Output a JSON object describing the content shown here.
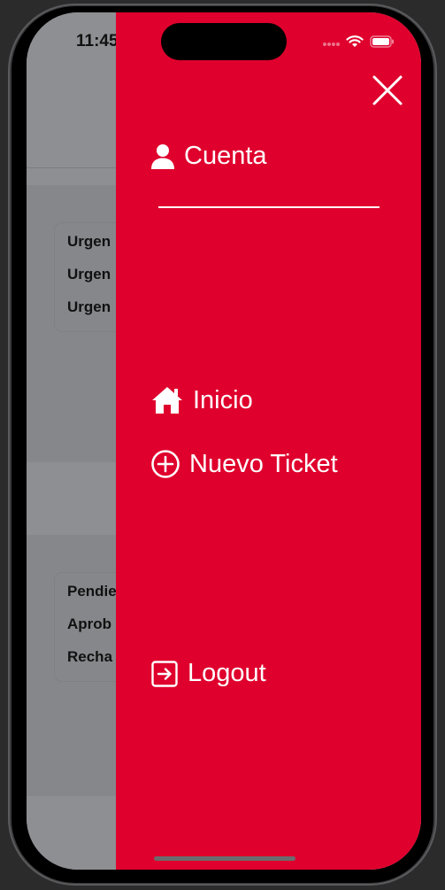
{
  "status_bar": {
    "time": "11:45"
  },
  "background_app": {
    "priority_items": [
      "Urgen",
      "Urgen",
      "Urgen"
    ],
    "status_items": [
      "Pendie",
      "Aprob",
      "Recha"
    ]
  },
  "menu": {
    "account_label": "Cuenta",
    "items": [
      {
        "label": "Inicio",
        "icon": "home-icon"
      },
      {
        "label": "Nuevo Ticket",
        "icon": "plus-circle-icon"
      }
    ],
    "logout_label": "Logout"
  },
  "colors": {
    "menu_bg": "#df002d",
    "overlay": "#8a8b8f",
    "text": "#ffffff"
  }
}
